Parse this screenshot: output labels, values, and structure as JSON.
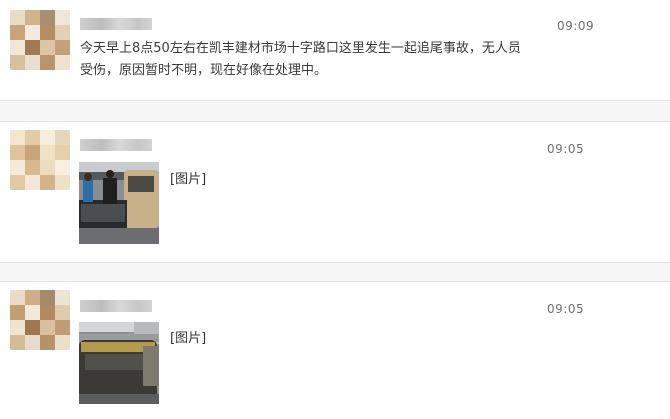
{
  "messages": [
    {
      "time": "09:09",
      "text_line1": "今天早上8点50左右在凯丰建材市场十字路口这里发生一起追尾事故，无人员",
      "text_line2": "受伤，原因暂时不明，现在好像在处理中。"
    },
    {
      "time": "09:05",
      "image_label": "[图片]"
    },
    {
      "time": "09:05",
      "image_label": "[图片]"
    }
  ]
}
